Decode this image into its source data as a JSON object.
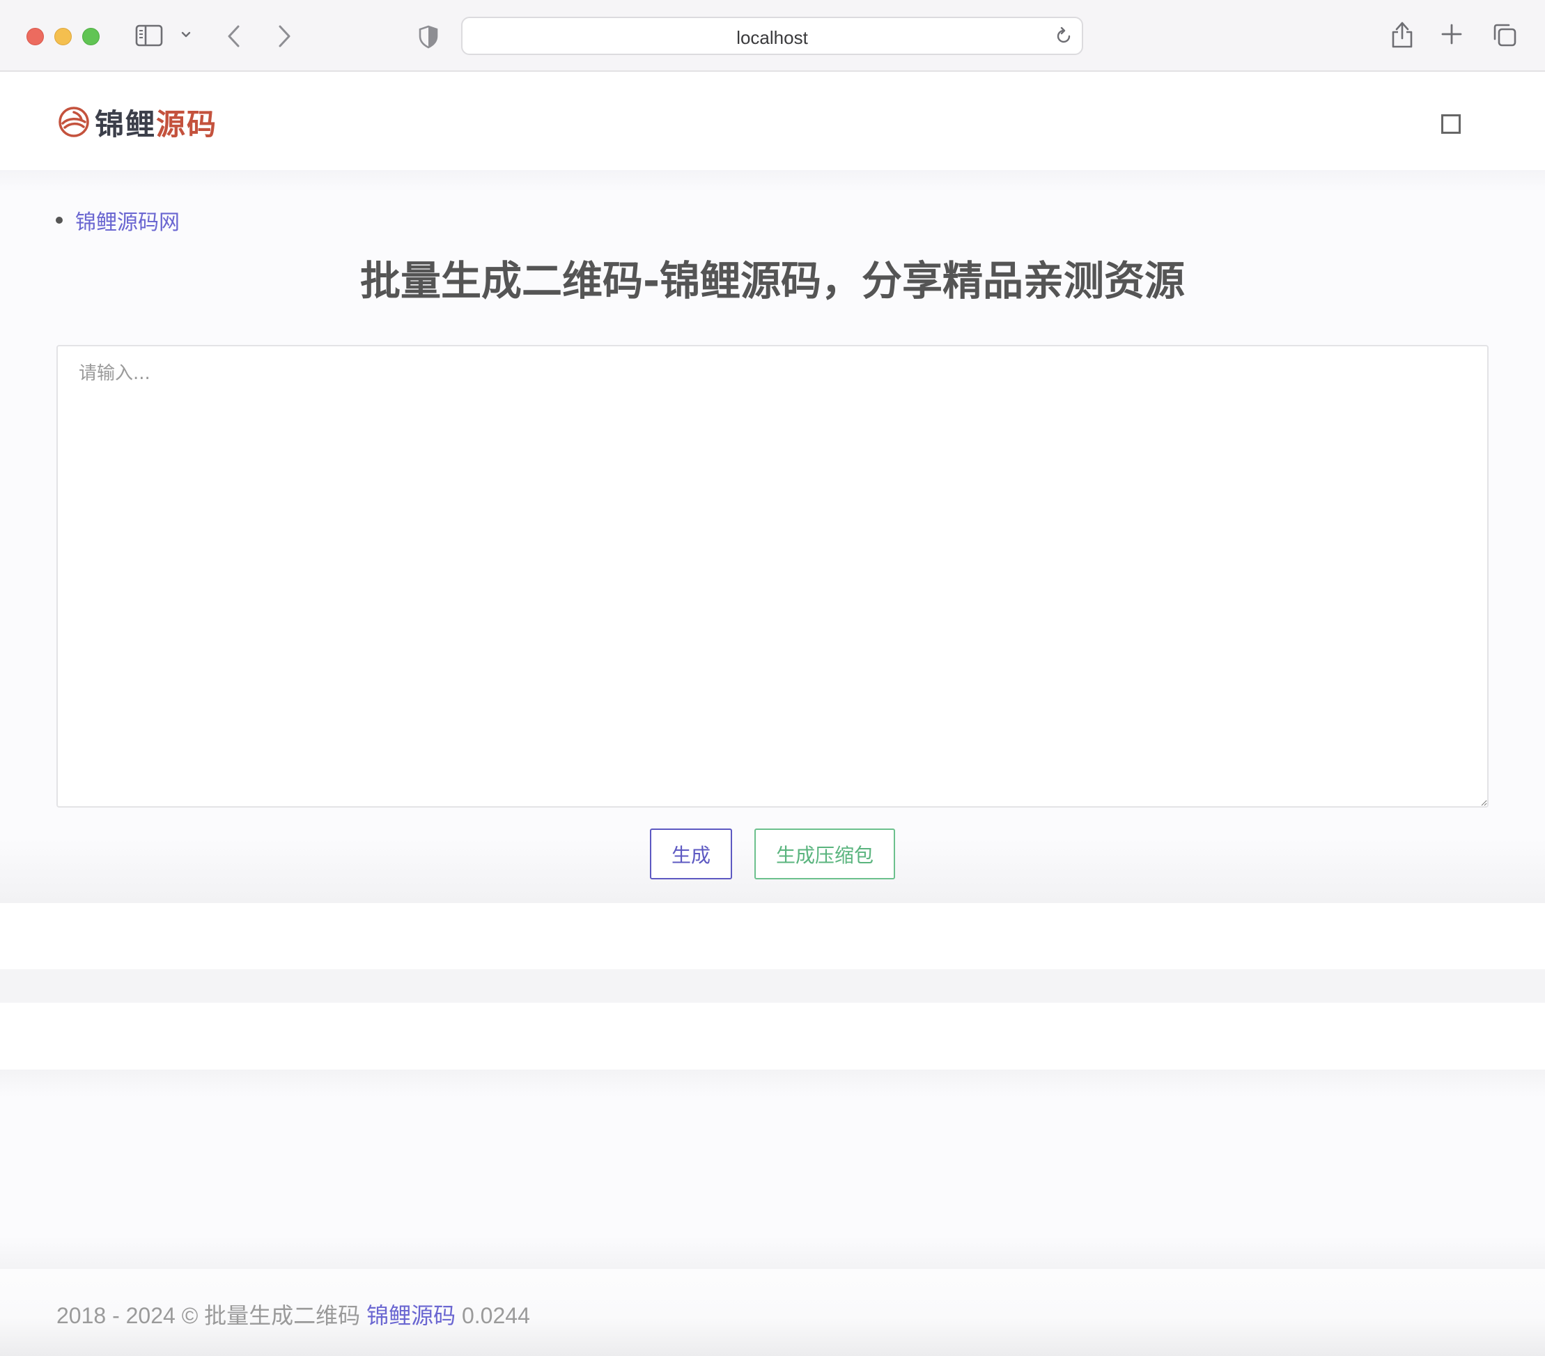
{
  "browser": {
    "url": "localhost",
    "icons": {
      "close": "close-button",
      "minimize": "minimize-button",
      "maximize": "maximize-button",
      "sidebar": "sidebar-icon",
      "back": "chevron-left-icon",
      "forward": "chevron-right-icon",
      "privacy": "shield-icon",
      "reload": "reload-icon",
      "share": "share-icon",
      "new_tab": "plus-icon",
      "tabs": "tabs-overview-icon"
    }
  },
  "header": {
    "logo_text_main": "锦鲤",
    "logo_text_accent": "源码",
    "menu_icon": "menu-toggle-icon"
  },
  "breadcrumb": {
    "link": "锦鲤源码网"
  },
  "main": {
    "title": "批量生成二维码-锦鲤源码，分享精品亲测资源",
    "textarea_placeholder": "请输入...",
    "textarea_value": "",
    "generate_button": "生成",
    "zip_button": "生成压缩包"
  },
  "footer": {
    "prefix": "2018 - 2024 © 批量生成二维码 ",
    "link": "锦鲤源码",
    "suffix": " 0.0244"
  },
  "colors": {
    "brand_dark": "#3c3f4a",
    "brand_accent": "#c4523d",
    "link": "#6a66d1",
    "primary_button": "#5d59c2",
    "success_button": "#6cc08d"
  }
}
